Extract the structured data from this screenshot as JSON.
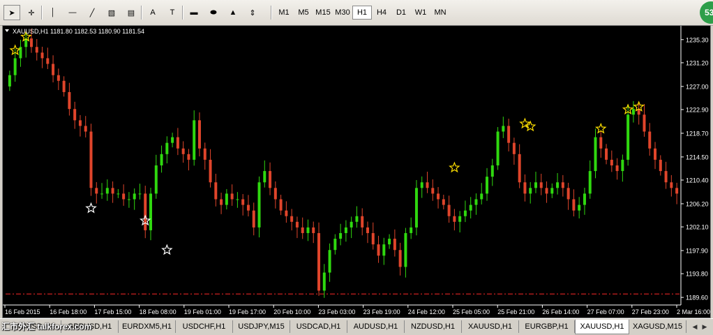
{
  "toolbar": {
    "tools": [
      {
        "icon": "cursor-icon",
        "glyph": "➤"
      },
      {
        "icon": "crosshair-icon",
        "glyph": "✛"
      },
      {
        "icon": "vertical-line-icon",
        "glyph": "│"
      },
      {
        "icon": "horizontal-line-icon",
        "glyph": "—"
      },
      {
        "icon": "trendline-icon",
        "glyph": "╱"
      },
      {
        "icon": "channel-icon",
        "glyph": "▧"
      },
      {
        "icon": "fibonacci-icon",
        "glyph": "▤"
      },
      {
        "icon": "text-icon",
        "glyph": "A"
      },
      {
        "icon": "text-label-icon",
        "glyph": "T"
      },
      {
        "icon": "rectangle-icon",
        "glyph": "▬"
      },
      {
        "icon": "ellipse-icon",
        "glyph": "⬬"
      },
      {
        "icon": "triangle-icon",
        "glyph": "▲"
      },
      {
        "icon": "arrows-icon",
        "glyph": "⇕"
      }
    ],
    "timeframes": [
      "M1",
      "M5",
      "M15",
      "M30",
      "H1",
      "H4",
      "D1",
      "W1",
      "MN"
    ],
    "active_timeframe": "H1",
    "badge": "53"
  },
  "chart": {
    "header": "XAUUSD,H1  1181.80 1182.53 1180.90 1181.54",
    "colors": {
      "up": "#2fd80f",
      "down": "#e0452b",
      "grid": "#333",
      "axis": "#ffffff",
      "star": "#ffe000",
      "line": "#cc2020"
    },
    "price_labels": [
      "1235.30",
      "1231.20",
      "1227.00",
      "1222.90",
      "1218.70",
      "1214.50",
      "1210.40",
      "1206.20",
      "1202.10",
      "1197.90",
      "1193.80",
      "1189.60"
    ],
    "time_labels": [
      "16 Feb 2015",
      "16 Feb 18:00",
      "17 Feb 15:00",
      "18 Feb 08:00",
      "19 Feb 01:00",
      "19 Feb 17:00",
      "20 Feb 10:00",
      "23 Feb 03:00",
      "23 Feb 19:00",
      "24 Feb 12:00",
      "25 Feb 05:00",
      "25 Feb 21:00",
      "26 Feb 14:00",
      "27 Feb 07:00",
      "27 Feb 23:00",
      "2 Mar 16:00"
    ]
  },
  "chart_data": {
    "type": "candlestick",
    "symbol": "XAUUSD",
    "timeframe": "H1",
    "ylim": [
      1188.5,
      1237.5
    ],
    "red_dashdot_level": 1190.2,
    "closes": [
      1229,
      1232,
      1234,
      1235.5,
      1234,
      1233,
      1232,
      1231,
      1229,
      1228,
      1226,
      1223,
      1221,
      1220,
      1219,
      1209,
      1208,
      1208,
      1209,
      1208,
      1208,
      1207,
      1207,
      1208,
      1208,
      1201.5,
      1208,
      1213,
      1215,
      1217,
      1218,
      1216,
      1215,
      1214,
      1221,
      1216,
      1214,
      1210,
      1207,
      1206,
      1208,
      1207,
      1207,
      1206,
      1205,
      1202,
      1210,
      1212,
      1209,
      1207,
      1205,
      1204,
      1203,
      1202,
      1201,
      1202,
      1201,
      1190.8,
      1194,
      1198,
      1200,
      1201,
      1202,
      1203,
      1204,
      1202,
      1201,
      1199,
      1197,
      1199,
      1200,
      1198,
      1195,
      1201,
      1202,
      1209,
      1210,
      1209,
      1208,
      1207,
      1206,
      1204,
      1203,
      1204,
      1205,
      1206,
      1207,
      1208,
      1211,
      1213,
      1219,
      1220,
      1217,
      1215,
      1210,
      1208,
      1209,
      1210,
      1209,
      1208,
      1209,
      1210,
      1209,
      1207,
      1205,
      1206,
      1208,
      1212,
      1218,
      1216,
      1214,
      1213,
      1212,
      1214,
      1222,
      1223,
      1222,
      1219,
      1216,
      1214,
      1212,
      1210,
      1209,
      1208
    ],
    "stars": [
      {
        "index": 1,
        "price": 1233.4,
        "color": "yellow"
      },
      {
        "index": 3,
        "price": 1235.8,
        "color": "yellow"
      },
      {
        "index": 15,
        "price": 1205.4,
        "color": "white"
      },
      {
        "index": 25,
        "price": 1203.2,
        "color": "white"
      },
      {
        "index": 29,
        "price": 1198.0,
        "color": "white"
      },
      {
        "index": 82,
        "price": 1212.6,
        "color": "yellow"
      },
      {
        "index": 95,
        "price": 1220.4,
        "color": "yellow"
      },
      {
        "index": 96,
        "price": 1219.9,
        "color": "yellow"
      },
      {
        "index": 109,
        "price": 1219.5,
        "color": "yellow"
      },
      {
        "index": 114,
        "price": 1222.9,
        "color": "yellow"
      },
      {
        "index": 116,
        "price": 1223.4,
        "color": "yellow"
      }
    ]
  },
  "tabs": {
    "items": [
      "XAUUSD,H1",
      "GBPUSD,H1",
      "EURDXM5,H1",
      "USDCHF,H1",
      "USDJPY,M15",
      "USDCAD,H1",
      "AUDUSD,H1",
      "NZDUSD,H1",
      "XAUUSD,H1",
      "EURGBP,H1",
      "XAUUSD,H1",
      "XAGUSD,M15"
    ],
    "active_index": 10,
    "watermark": "汇市外汇  talkforex.com"
  }
}
